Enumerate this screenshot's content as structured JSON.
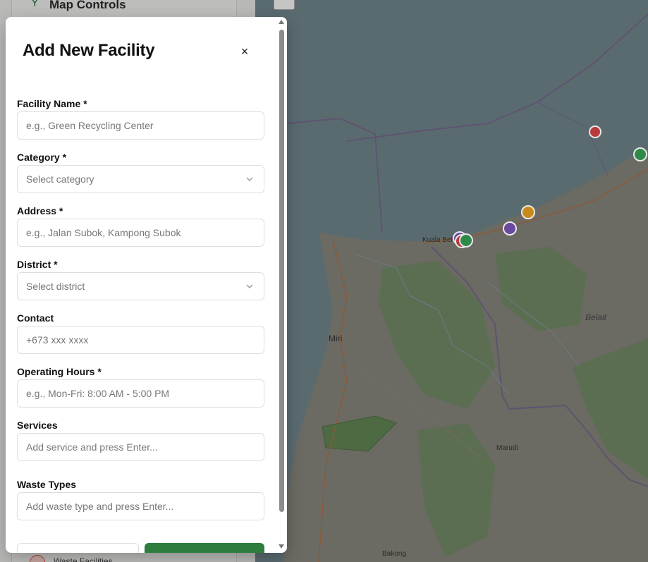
{
  "background": {
    "sidebar": {
      "controls_title": "Map Controls",
      "bottom_item_label": "Waste Facilities"
    },
    "map": {
      "labels": {
        "kuala_belait": "Kuala Bel",
        "miri": "Miri",
        "belait": "Belait",
        "marudi": "Marudi",
        "bakong": "Bakong"
      }
    }
  },
  "modal": {
    "title": "Add New Facility",
    "close_symbol": "×",
    "fields": {
      "facility_name": {
        "label": "Facility Name *",
        "placeholder": "e.g., Green Recycling Center"
      },
      "category": {
        "label": "Category *",
        "placeholder": "Select category"
      },
      "address": {
        "label": "Address *",
        "placeholder": "e.g., Jalan Subok, Kampong Subok"
      },
      "district": {
        "label": "District *",
        "placeholder": "Select district"
      },
      "contact": {
        "label": "Contact",
        "placeholder": "+673 xxx xxxx"
      },
      "operating_hours": {
        "label": "Operating Hours *",
        "placeholder": "e.g., Mon-Fri: 8:00 AM - 5:00 PM"
      },
      "services": {
        "label": "Services",
        "placeholder": "Add service and press Enter..."
      },
      "waste_types": {
        "label": "Waste Types",
        "placeholder": "Add waste type and press Enter..."
      }
    }
  },
  "colors": {
    "primary": "#2e7d3f",
    "marker_red": "#b93a3a",
    "marker_green": "#2f8a4a",
    "marker_purple": "#6a4aa0",
    "marker_orange": "#c78a1a"
  }
}
